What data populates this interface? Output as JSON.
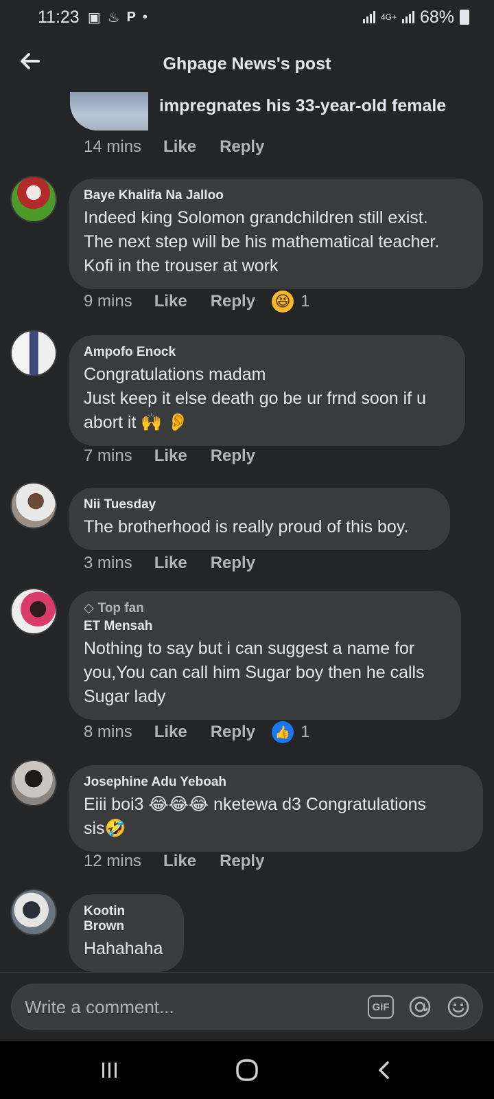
{
  "status": {
    "time": "11:23",
    "network": "4G+",
    "battery": "68%"
  },
  "header": {
    "title": "Ghpage News's post"
  },
  "previous_post": {
    "title_fragment": "impregnates his 33-year-old female",
    "time": "14 mins",
    "like_label": "Like",
    "reply_label": "Reply"
  },
  "comments": [
    {
      "name": "Baye Khalifa Na Jalloo",
      "lines": [
        "Indeed king Solomon grandchildren still exist.",
        "The next step will be his mathematical teacher.",
        "Kofi in the trouser at work"
      ],
      "time": "9 mins",
      "like_label": "Like",
      "reply_label": "Reply",
      "reaction": "laugh",
      "reaction_count": "1"
    },
    {
      "name": "Ampofo Enock",
      "lines": [
        "Congratulations madam",
        "Just keep it else death go be ur frnd soon if u",
        "abort it 🙌 👂"
      ],
      "time": "7 mins",
      "like_label": "Like",
      "reply_label": "Reply"
    },
    {
      "name": "Nii Tuesday",
      "lines": [
        "The brotherhood is really proud of this boy."
      ],
      "time": "3 mins",
      "like_label": "Like",
      "reply_label": "Reply"
    },
    {
      "badge": "Top fan",
      "name": "ET Mensah",
      "lines": [
        "Nothing to say but i can suggest a name for",
        "you,You can call him Sugar boy then he calls",
        "Sugar lady"
      ],
      "time": "8 mins",
      "like_label": "Like",
      "reply_label": "Reply",
      "reaction": "like",
      "reaction_count": "1"
    },
    {
      "name": "Josephine Adu Yeboah",
      "lines": [
        "Eiii boi3 😂😂😂 nketewa d3   Congratulations",
        "sis🤣"
      ],
      "time": "12 mins",
      "like_label": "Like",
      "reply_label": "Reply"
    },
    {
      "name": "Kootin Brown",
      "lines": [
        "Hahahaha"
      ]
    }
  ],
  "composer": {
    "placeholder": "Write a comment...",
    "gif_label": "GIF"
  },
  "colors": {
    "background": "#242526",
    "bubble": "#3a3b3c",
    "text": "#e4e6eb",
    "muted": "#b0b3b8",
    "like_blue": "#1877f2",
    "emoji_yellow": "#f7b928"
  }
}
